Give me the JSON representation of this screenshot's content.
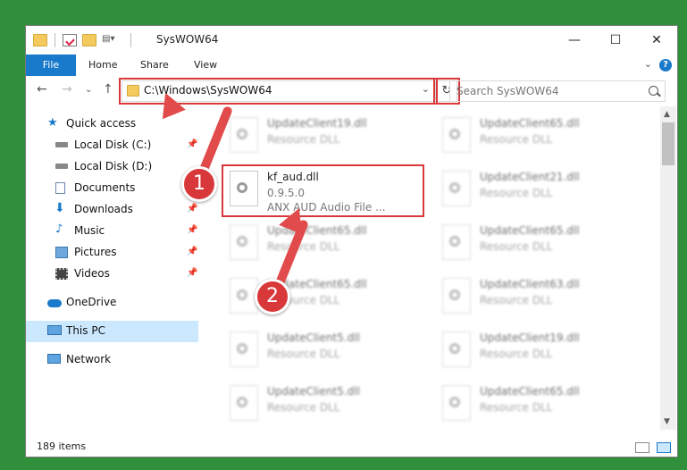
{
  "window": {
    "title": "SysWOW64"
  },
  "ribbon": {
    "tabs": [
      "File",
      "Home",
      "Share",
      "View"
    ],
    "help_label": "?"
  },
  "nav": {
    "address": "C:\\Windows\\SysWOW64",
    "search_placeholder": "Search SysWOW64"
  },
  "sidebar": {
    "items": [
      {
        "label": "Quick access",
        "icon": "star-icon"
      },
      {
        "label": "Local Disk (C:)",
        "icon": "drive-icon"
      },
      {
        "label": "Local Disk (D:)",
        "icon": "drive-icon"
      },
      {
        "label": "Documents",
        "icon": "documents-icon"
      },
      {
        "label": "Downloads",
        "icon": "download-icon"
      },
      {
        "label": "Music",
        "icon": "music-icon"
      },
      {
        "label": "Pictures",
        "icon": "pictures-icon"
      },
      {
        "label": "Videos",
        "icon": "videos-icon"
      },
      {
        "label": "OneDrive",
        "icon": "cloud-icon"
      },
      {
        "label": "This PC",
        "icon": "computer-icon"
      },
      {
        "label": "Network",
        "icon": "network-icon"
      }
    ]
  },
  "files": {
    "left": [
      {
        "name": "UpdateClient19.dll",
        "desc": "Resource DLL"
      },
      {
        "name": "kf_aud.dll",
        "version": "0.9.5.0",
        "desc": "ANX AUD Audio File ..."
      },
      {
        "name": "UpdateClient65.dll",
        "desc": "Resource DLL"
      },
      {
        "name": "UpdateClient65.dll",
        "desc": "Resource DLL"
      },
      {
        "name": "UpdateClient5.dll",
        "desc": "Resource DLL"
      },
      {
        "name": "UpdateClient5.dll",
        "desc": "Resource DLL"
      }
    ],
    "right": [
      {
        "name": "UpdateClient65.dll",
        "desc": "Resource DLL"
      },
      {
        "name": "UpdateClient21.dll",
        "desc": "Resource DLL"
      },
      {
        "name": "UpdateClient65.dll",
        "desc": "Resource DLL"
      },
      {
        "name": "UpdateClient63.dll",
        "desc": "Resource DLL"
      },
      {
        "name": "UpdateClient19.dll",
        "desc": "Resource DLL"
      },
      {
        "name": "UpdateClient65.dll",
        "desc": "Resource DLL"
      }
    ]
  },
  "status": {
    "item_count": "189 items"
  },
  "annotations": {
    "step1": "1",
    "step2": "2",
    "color": "#d9383a"
  }
}
